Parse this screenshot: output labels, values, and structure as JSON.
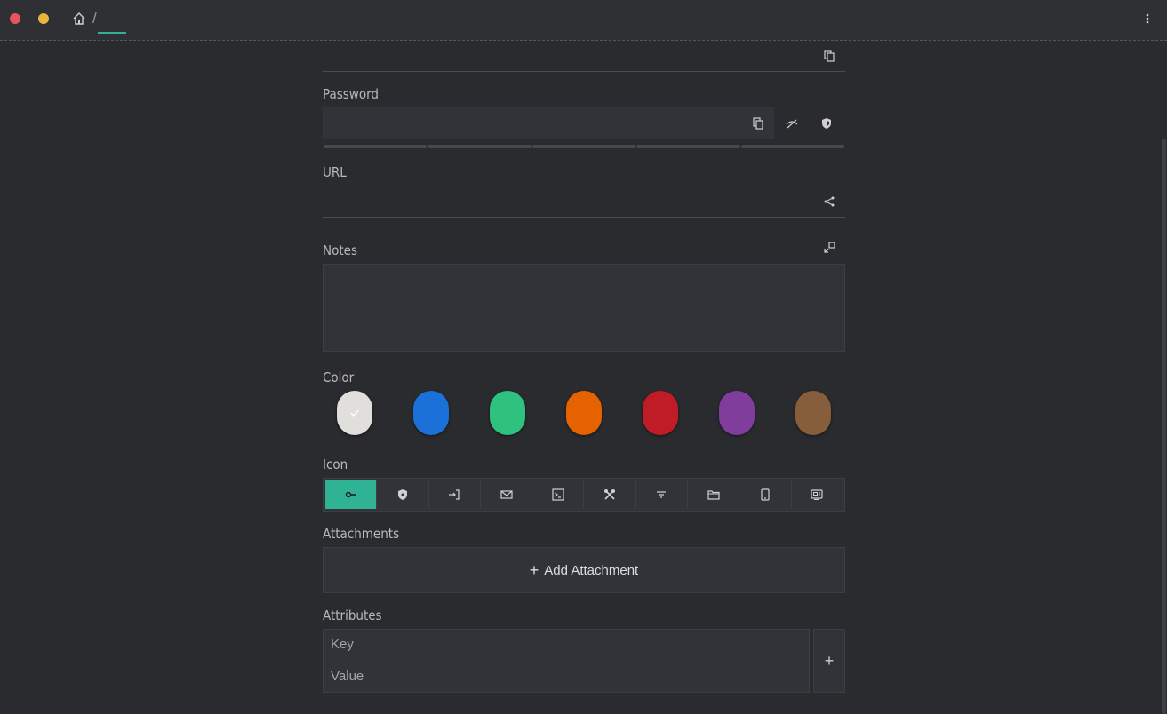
{
  "titlebar": {
    "breadcrumb_separator": "/",
    "home_icon": "home-icon",
    "menu_icon": "more-vertical-icon"
  },
  "fields": {
    "username_copy_icon": "copy-icon",
    "password_label": "Password",
    "password_value": "",
    "password_icons": [
      "copy-icon",
      "eye-off-icon",
      "shield-icon"
    ],
    "url_label": "URL",
    "url_value": "",
    "url_icon": "share-icon",
    "notes_label": "Notes",
    "notes_value": "",
    "notes_icon": "expand-icon"
  },
  "color": {
    "label": "Color",
    "swatches": [
      "#e0dfdc",
      "#1c71d8",
      "#2ec27e",
      "#e66100",
      "#c01c28",
      "#813d9c",
      "#865e3c"
    ],
    "selected_index": 0
  },
  "icon": {
    "label": "Icon",
    "options": [
      "key-icon",
      "shield-icon",
      "login-icon",
      "envelope-icon",
      "terminal-icon",
      "tools-icon",
      "filter-icon",
      "folder-icon",
      "tablet-icon",
      "screen-icon"
    ],
    "selected_index": 0
  },
  "attachments": {
    "label": "Attachments",
    "add_label": "Add Attachment"
  },
  "attributes": {
    "label": "Attributes",
    "key_placeholder": "Key",
    "value_placeholder": "Value",
    "add_label": "+"
  }
}
